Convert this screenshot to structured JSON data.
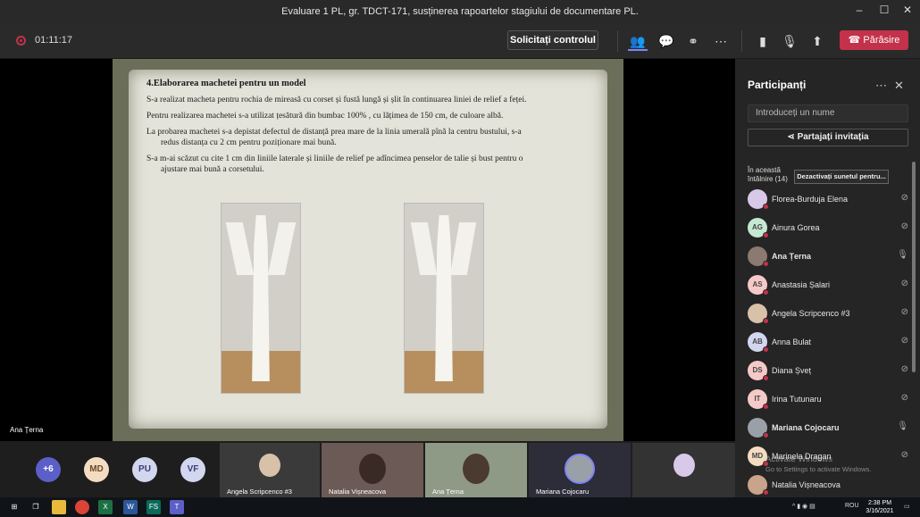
{
  "window": {
    "title": "Evaluare 1 PL, gr. TDCT-171, susținerea rapoartelor stagiului de documentare PL."
  },
  "toolbar": {
    "timer": "01:11:17",
    "request_control": "Solicitați controlul",
    "leave": "Părăsire"
  },
  "slide": {
    "title": "4.Elaborarea machetei pentru un model",
    "paragraphs": [
      "S-a realizat macheta pentru rochia de mireasă cu corset și fustă lungă și șlit în continuarea liniei de relief a feței.",
      "Pentru realizarea machetei s-a utilizat țesătură din bumbac 100% , cu lățimea de 150 cm, de culoare albă.",
      "La probarea machetei s-a depistat defectul de distanță prea mare de la linia umerală pînă la centru bustului, s-a",
      "redus distanța cu 2 cm pentru poziționare mai bună.",
      "S-a m-ai scăzut cu cite 1 cm din liniile laterale și liniile de relief pe adîncimea penselor de talie și bust pentru o",
      "ajustare mai bună a corsetului."
    ],
    "presenter": "Ana Țerna"
  },
  "participants": {
    "title": "Participanți",
    "search_placeholder": "Introduceți un nume",
    "share": "Partajați invitația",
    "in_meeting_line1": "În această",
    "in_meeting_line2": "întâlnire (14)",
    "mute_all": "Dezactivați sunetul pentru...",
    "list": [
      {
        "initials": "",
        "name": "Florea-Burduja Elena",
        "mic": "muted",
        "color": "#d9c9e8"
      },
      {
        "initials": "AG",
        "name": "Ainura Gorea",
        "mic": "muted",
        "color": "#c5e8d3"
      },
      {
        "initials": "",
        "name": "Ana Țerna",
        "mic": "on",
        "color": "#8a7a70"
      },
      {
        "initials": "AS",
        "name": "Anastasia Șalari",
        "mic": "muted",
        "color": "#f6c9c9"
      },
      {
        "initials": "",
        "name": "Angela Scripcenco #3",
        "mic": "muted",
        "color": "#d8c1a9"
      },
      {
        "initials": "AB",
        "name": "Anna Bulat",
        "mic": "muted",
        "color": "#d2d6ee"
      },
      {
        "initials": "DS",
        "name": "Diana Șveț",
        "mic": "muted",
        "color": "#f6c9c9"
      },
      {
        "initials": "IT",
        "name": "Irina Tutunaru",
        "mic": "muted",
        "color": "#f6c9c9"
      },
      {
        "initials": "",
        "name": "Mariana Cojocaru",
        "mic": "on",
        "color": "#9aa0a8"
      },
      {
        "initials": "MD",
        "name": "Marinela Dragan",
        "mic": "muted",
        "color": "#f3dcc2"
      },
      {
        "initials": "",
        "name": "Natalia Vișneacova",
        "mic": "",
        "color": "#c9a38a"
      }
    ]
  },
  "bottom": {
    "bubbles": [
      {
        "label": "+6",
        "color": "#5b5fc7",
        "text": "#ffffff"
      },
      {
        "label": "MD",
        "color": "#f3dcc2",
        "text": "#6b4b2a"
      },
      {
        "label": "PU",
        "color": "#d2d6ee",
        "text": "#3b3f7a"
      },
      {
        "label": "VF",
        "color": "#d2d6ee",
        "text": "#3b3f7a"
      }
    ],
    "tiles": [
      {
        "name": "Angela Scripcenco #3"
      },
      {
        "name": "Natalia Vișneacova"
      },
      {
        "name": "Ana Țerna"
      },
      {
        "name": "Mariana Cojocaru"
      }
    ]
  },
  "watermark": {
    "line1": "Activate Windows",
    "line2": "Go to Settings to activate Windows."
  },
  "taskbar": {
    "time": "2:38 PM",
    "date": "3/16/2021",
    "lang": "ROU"
  }
}
